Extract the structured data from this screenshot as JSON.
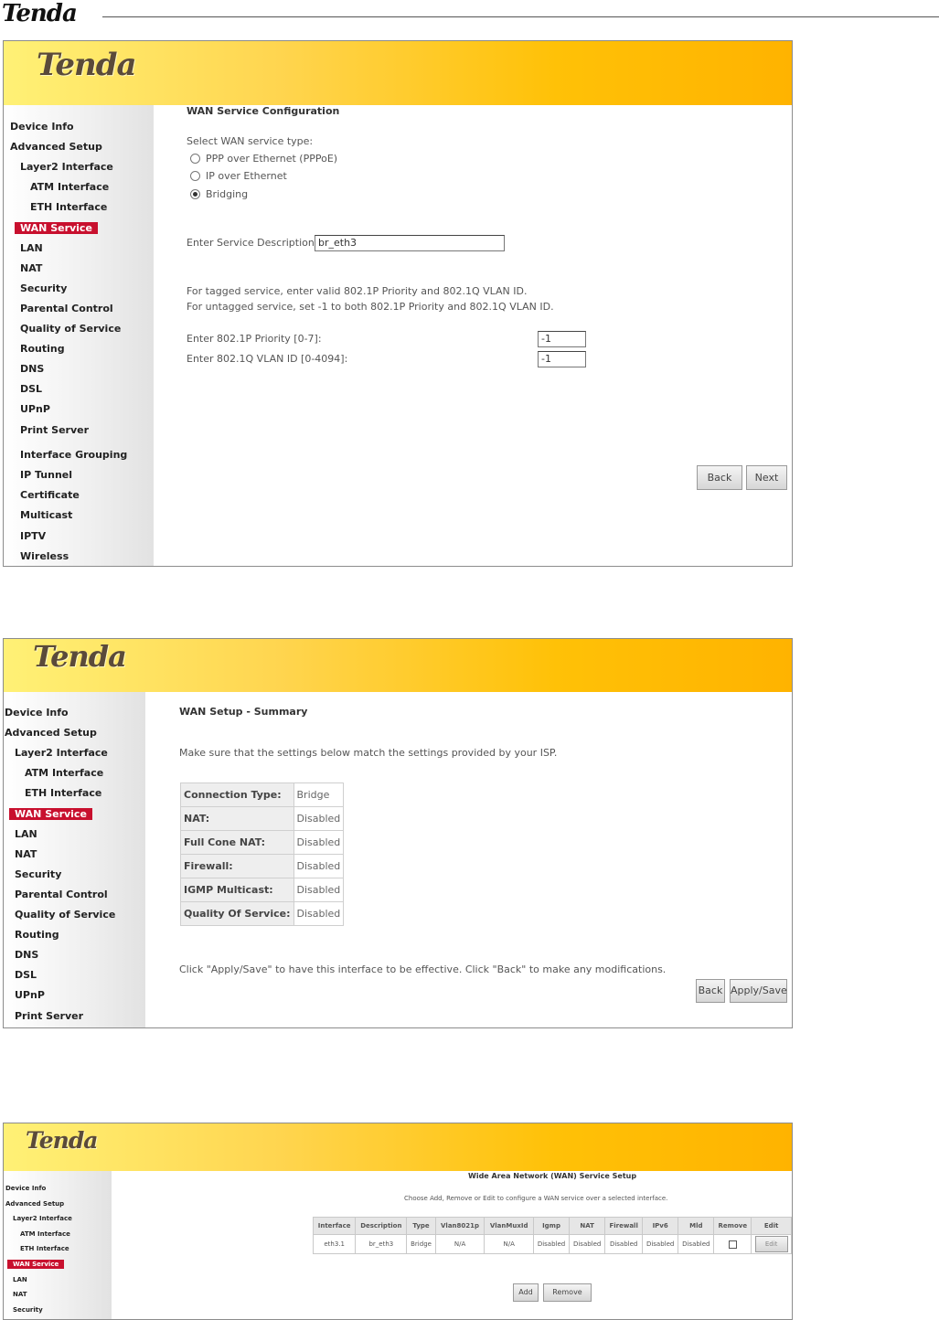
{
  "document": {
    "logo": "Tenda"
  },
  "sidebar_items": [
    "Device Info",
    "Advanced Setup",
    "Layer2 Interface",
    "ATM Interface",
    "ETH Interface",
    "WAN Service",
    "LAN",
    "NAT",
    "Security",
    "Parental Control",
    "Quality of Service",
    "Routing",
    "DNS",
    "DSL",
    "UPnP",
    "Print Server",
    "Interface Grouping",
    "IP Tunnel",
    "Certificate",
    "Multicast",
    "IPTV",
    "Wireless"
  ],
  "panel1": {
    "logo": "Tenda",
    "title": "WAN Service Configuration",
    "select_label": "Select WAN service type:",
    "options": [
      "PPP over Ethernet (PPPoE)",
      "IP over Ethernet",
      "Bridging"
    ],
    "selected_option": "Bridging",
    "desc_label": "Enter Service Description:",
    "desc_value": "br_eth3",
    "note1": "For tagged service, enter valid 802.1P Priority and 802.1Q VLAN ID.",
    "note2": "For untagged service, set -1 to both 802.1P Priority and 802.1Q VLAN ID.",
    "priority_label": "Enter 802.1P Priority [0-7]:",
    "priority_value": "-1",
    "vlan_label": "Enter 802.1Q VLAN ID [0-4094]:",
    "vlan_value": "-1",
    "back": "Back",
    "next": "Next"
  },
  "panel2": {
    "logo": "Tenda",
    "title": "WAN Setup - Summary",
    "intro": "Make sure that the settings below match the settings provided by your ISP.",
    "rows": [
      {
        "k": "Connection Type:",
        "v": "Bridge"
      },
      {
        "k": "NAT:",
        "v": "Disabled"
      },
      {
        "k": "Full Cone NAT:",
        "v": "Disabled"
      },
      {
        "k": "Firewall:",
        "v": "Disabled"
      },
      {
        "k": "IGMP Multicast:",
        "v": "Disabled"
      },
      {
        "k": "Quality Of Service:",
        "v": "Disabled"
      }
    ],
    "footer": "Click \"Apply/Save\" to have this interface to be effective. Click \"Back\" to make any modifications.",
    "back": "Back",
    "apply": "Apply/Save"
  },
  "panel3": {
    "logo": "Tenda",
    "title": "Wide Area Network (WAN) Service Setup",
    "subtitle": "Choose Add, Remove or Edit to configure a WAN service over a selected interface.",
    "columns": [
      "Interface",
      "Description",
      "Type",
      "Vlan8021p",
      "VlanMuxId",
      "Igmp",
      "NAT",
      "Firewall",
      "IPv6",
      "Mld",
      "Remove",
      "Edit"
    ],
    "row": [
      "eth3.1",
      "br_eth3",
      "Bridge",
      "N/A",
      "N/A",
      "Disabled",
      "Disabled",
      "Disabled",
      "Disabled",
      "Disabled"
    ],
    "edit": "Edit",
    "add": "Add",
    "remove": "Remove"
  }
}
